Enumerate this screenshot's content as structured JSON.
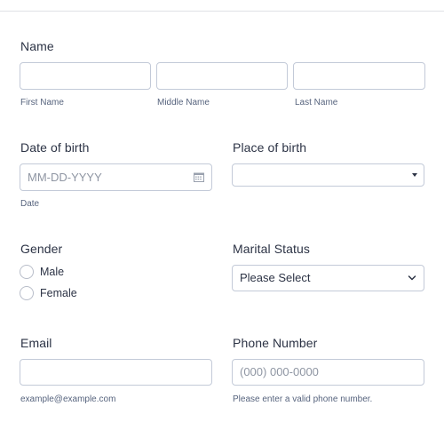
{
  "name": {
    "label": "Name",
    "first_sublabel": "First Name",
    "middle_sublabel": "Middle Name",
    "last_sublabel": "Last Name",
    "first_value": "",
    "middle_value": "",
    "last_value": ""
  },
  "dob": {
    "label": "Date of birth",
    "placeholder": "MM-DD-YYYY",
    "sublabel": "Date"
  },
  "place_of_birth": {
    "label": "Place of birth",
    "selected": ""
  },
  "gender": {
    "label": "Gender",
    "options": [
      "Male",
      "Female"
    ]
  },
  "marital_status": {
    "label": "Marital Status",
    "selected": "Please Select"
  },
  "email": {
    "label": "Email",
    "value": "",
    "sublabel": "example@example.com"
  },
  "phone": {
    "label": "Phone Number",
    "placeholder": "(000) 000-0000",
    "sublabel": "Please enter a valid phone number."
  },
  "icons": {
    "calendar": "calendar-icon",
    "dropdown": "chevron-down-icon",
    "caret": "caret-down-icon"
  },
  "colors": {
    "text": "#2c3345",
    "sublabel": "#57647e",
    "placeholder": "#8f96a3",
    "border": "#c3cad8"
  }
}
